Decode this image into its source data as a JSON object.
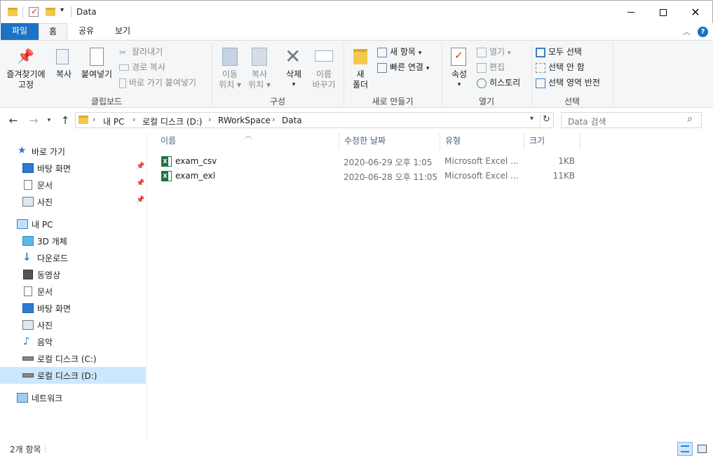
{
  "window": {
    "title": "Data",
    "minimize_icon": "minimize-icon",
    "maximize_icon": "maximize-icon",
    "close_icon": "close-icon"
  },
  "ribbon_tabs": [
    "파일",
    "홈",
    "공유",
    "보기"
  ],
  "ribbon": {
    "clipboard": {
      "label": "클립보드",
      "pin_label_1": "즐겨찾기에",
      "pin_label_2": "고정",
      "copy_label": "복사",
      "paste_label": "붙여넣기",
      "cut_label": "잘라내기",
      "copy_path_label": "경로 복사",
      "paste_shortcut_label": "바로 가기 붙여넣기"
    },
    "organize": {
      "label": "구성",
      "move_label_1": "이동",
      "move_label_2": "위치",
      "copyto_label_1": "복사",
      "copyto_label_2": "위치",
      "delete_label": "삭제",
      "rename_label_1": "이름",
      "rename_label_2": "바꾸기"
    },
    "new": {
      "label": "새로 만들기",
      "new_folder_label_1": "새",
      "new_folder_label_2": "폴더",
      "new_item_label": "새 항목",
      "easy_access_label": "빠른 연결"
    },
    "open": {
      "label": "열기",
      "properties_label": "속성",
      "open_label": "열기",
      "edit_label": "편집",
      "history_label": "히스토리"
    },
    "select": {
      "label": "선택",
      "select_all_label": "모두 선택",
      "select_none_label": "선택 안 함",
      "invert_label": "선택 영역 반전"
    }
  },
  "address": {
    "crumbs": [
      "내 PC",
      "로컬 디스크 (D:)",
      "RWorkSpace",
      "Data"
    ],
    "search_placeholder": "Data 검색"
  },
  "nav": {
    "quick_access": "바로 가기",
    "quick_items": [
      "바탕 화면",
      "문서",
      "사진"
    ],
    "this_pc": "내 PC",
    "pc_items": [
      "3D 개체",
      "다운로드",
      "동영상",
      "문서",
      "바탕 화면",
      "사진",
      "음악",
      "로컬 디스크 (C:)",
      "로컬 디스크 (D:)"
    ],
    "network": "네트워크"
  },
  "columns": [
    "이름",
    "수정한 날짜",
    "유형",
    "크기"
  ],
  "files": [
    {
      "name": "exam_csv",
      "modified": "2020-06-29 오후 1:05",
      "type": "Microsoft Excel ...",
      "size": "1KB"
    },
    {
      "name": "exam_exl",
      "modified": "2020-06-28 오후 11:05",
      "type": "Microsoft Excel ...",
      "size": "11KB"
    }
  ],
  "status": {
    "item_count": "2개 항목"
  },
  "colors": {
    "file_tab": "#1a73c4",
    "selection": "#cce8ff",
    "ribbon_bg": "#f5f6f7"
  }
}
